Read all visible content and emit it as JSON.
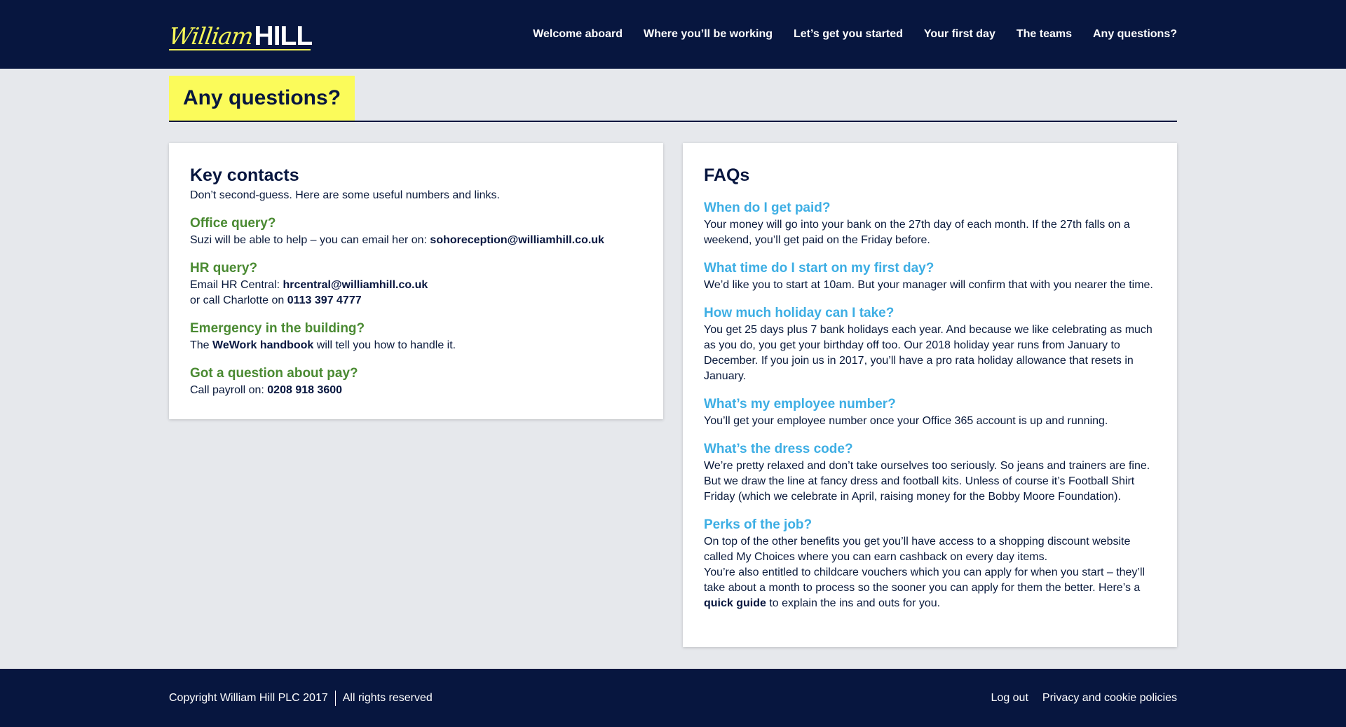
{
  "brand": {
    "logo_script": "William",
    "logo_block": "HILL",
    "colors": {
      "navy": "#07163f",
      "yellow": "#fbfb5a",
      "green": "#4a8a32",
      "blue": "#3daee4"
    }
  },
  "nav": {
    "items": [
      {
        "label": "Welcome aboard"
      },
      {
        "label": "Where you’ll be working"
      },
      {
        "label": "Let’s get you started"
      },
      {
        "label": "Your first day"
      },
      {
        "label": "The teams"
      },
      {
        "label": "Any questions?"
      }
    ]
  },
  "page": {
    "title": "Any questions?"
  },
  "contacts": {
    "title": "Key contacts",
    "intro": "Don’t second-guess. Here are some useful numbers and links.",
    "office": {
      "heading": "Office query?",
      "text": "Suzi will be able to help – you can email her on: ",
      "email": "sohoreception@williamhill.co.uk"
    },
    "hr": {
      "heading": "HR query?",
      "text1": "Email HR Central: ",
      "email": "hrcentral@williamhill.co.uk",
      "text2": "or call Charlotte on ",
      "phone": "0113 397 4777"
    },
    "emergency": {
      "heading": "Emergency in the building?",
      "text1": "The ",
      "link": "WeWork handbook",
      "text2": " will tell you how to handle it."
    },
    "pay": {
      "heading": "Got a question about pay?",
      "text": "Call payroll on: ",
      "phone": "0208 918 3600"
    }
  },
  "faqs": {
    "title": "FAQs",
    "paid": {
      "q": "When do I get paid?",
      "a": "Your money will go into your bank on the 27th day of each month. If the 27th falls on a weekend, you’ll get paid on the Friday before."
    },
    "start": {
      "q": "What time do I start on my first day?",
      "a": "We’d like you to start at 10am. But your manager will confirm that with you nearer the time."
    },
    "holiday": {
      "q": "How much holiday can I take?",
      "a": "You get 25 days plus 7 bank holidays each year. And because we like celebrating as much as you do, you get your birthday off too. Our 2018 holiday year runs from January to December. If you join us in 2017, you’ll have a pro rata holiday allowance that resets in January."
    },
    "employee": {
      "q": "What’s my employee number?",
      "a": "You’ll get your employee number once your Office 365 account is up and running."
    },
    "dress": {
      "q": "What’s the dress code?",
      "a": "We’re pretty relaxed and don’t take ourselves too seriously. So jeans and trainers are fine. But we draw the line at fancy dress and football kits. Unless of course it’s Football Shirt Friday (which we celebrate in April, raising money for the Bobby Moore Foundation)."
    },
    "perks": {
      "q": "Perks of the job?",
      "a1": "On top of the other benefits you get you’ll have access to a shopping discount website called My Choices where you can earn cashback on every day items.",
      "a2": "You’re also entitled to childcare vouchers which you can apply for when you start – they’ll take about a month to process so the sooner you can apply for them the better. Here’s a ",
      "link": "quick guide",
      "a3": " to explain the ins and outs for you."
    }
  },
  "footer": {
    "copyright": "Copyright William Hill PLC 2017",
    "rights": "All rights reserved",
    "links": [
      {
        "label": "Log out"
      },
      {
        "label": "Privacy and cookie policies"
      }
    ]
  }
}
